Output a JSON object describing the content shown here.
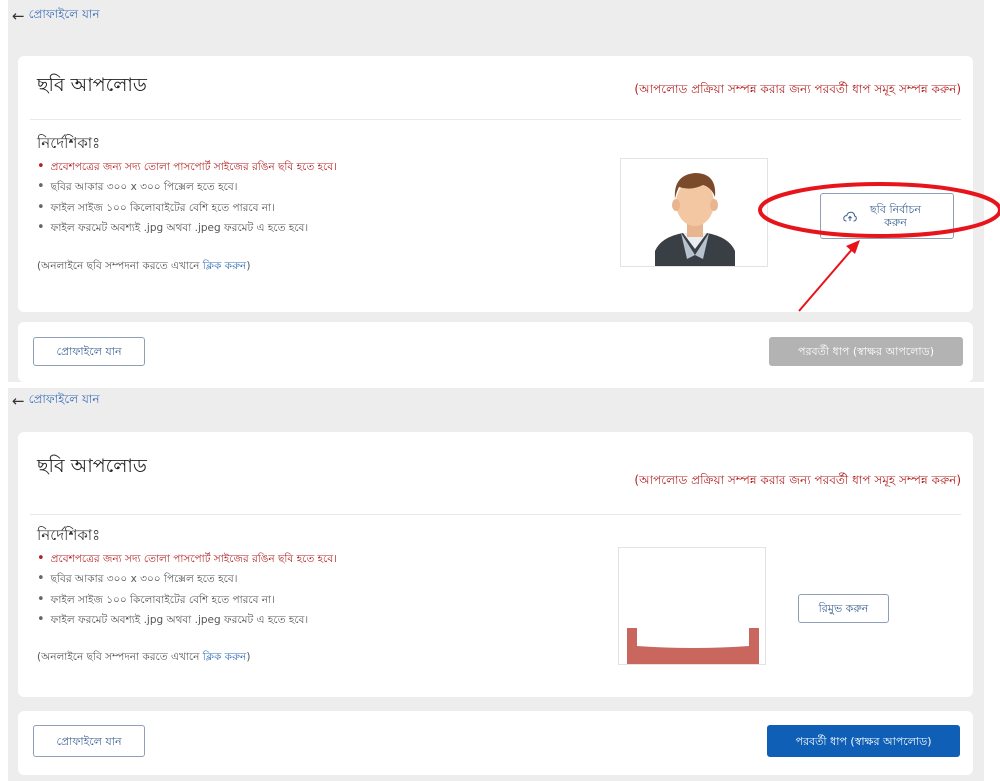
{
  "top": {
    "back_link": "প্রোফাইলে যান",
    "title": "ছবি আপলোড",
    "note": "(আপলোড প্রক্রিয়া সম্পন্ন করার জন্য পরবর্তী ধাপ সমূহ সম্পন্ন করুন)",
    "guide_heading": "নির্দেশিকাঃ",
    "guidelines": [
      "প্রবেশপত্রের জন্য সদ্য তোলা পাসপোর্ট সাইজের রঙিন ছবি হতে হবে।",
      "ছবির আকার ৩০০ x ৩০০ পিক্সেল হতে হবে।",
      "ফাইল সাইজ ১০০ কিলোবাইটের বেশি হতে পারবে না।",
      "ফাইল ফরমেট অবশ্যই .jpg অথবা .jpeg ফরমেট এ হতে হবে।"
    ],
    "edit_prefix": "(অনলাইনে ছবি সম্পদনা করতে এখানে ",
    "edit_link": "ক্লিক করুন",
    "edit_suffix": ")",
    "select_photo_button": "ছবি নির্বাচন করুন",
    "profile_button": "প্রোফাইলে যান",
    "next_button": "পরবর্তী ধাপ (স্বাক্ষর আপলোড)"
  },
  "bottom": {
    "back_link": "প্রোফাইলে যান",
    "title": "ছবি আপলোড",
    "note": "(আপলোড প্রক্রিয়া সম্পন্ন করার জন্য পরবর্তী ধাপ সমূহ সম্পন্ন করুন)",
    "guide_heading": "নির্দেশিকাঃ",
    "guidelines": [
      "প্রবেশপত্রের জন্য সদ্য তোলা পাসপোর্ট সাইজের রঙিন ছবি হতে হবে।",
      "ছবির আকার ৩০০ x ৩০০ পিক্সেল হতে হবে।",
      "ফাইল সাইজ ১০০ কিলোবাইটের বেশি হতে পারবে না।",
      "ফাইল ফরমেট অবশ্যই .jpg অথবা .jpeg ফরমেট এ হতে হবে।"
    ],
    "edit_prefix": "(অনলাইনে ছবি সম্পদনা করতে এখানে ",
    "edit_link": "ক্লিক করুন",
    "edit_suffix": ")",
    "remove_button": "রিমুভ করুন",
    "profile_button": "প্রোফাইলে যান",
    "next_button": "পরবর্তী ধাপ (স্বাক্ষর আপলোড)"
  },
  "icons": {
    "back": "arrow-left-icon",
    "upload": "cloud-upload-icon",
    "bullet": "bullet-icon",
    "avatar": "person-avatar-icon"
  },
  "colors": {
    "warning_text": "#b21f1f",
    "link": "#2d6cb5",
    "primary_button": "#0e5fb5",
    "disabled_button": "#b3b3b3",
    "annotation_red": "#e8141b",
    "page_gray": "#ededed"
  }
}
